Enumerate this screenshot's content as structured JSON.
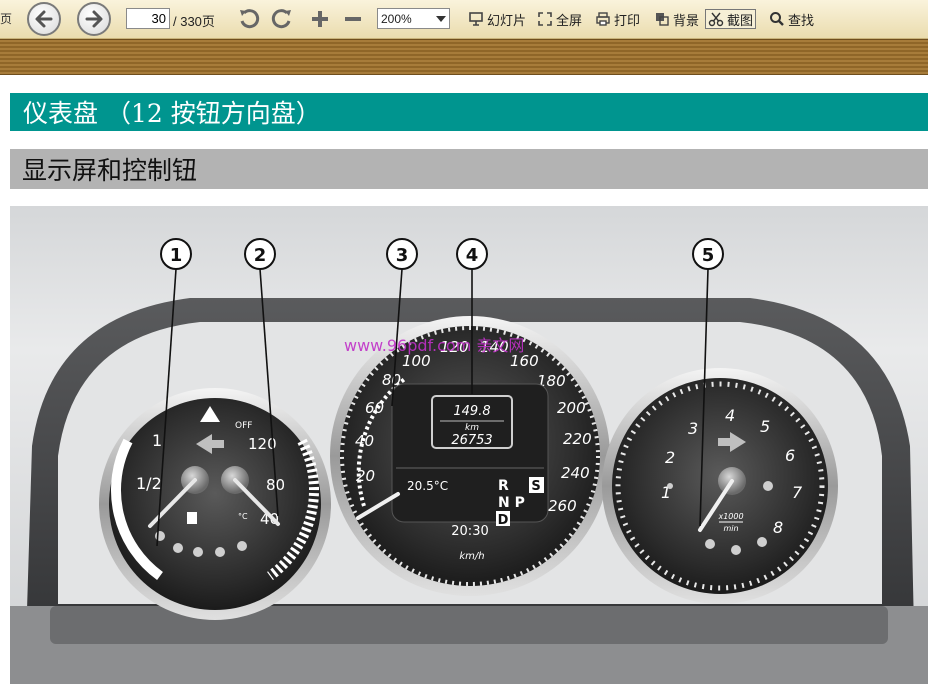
{
  "toolbar": {
    "edge_label": "页",
    "page_number": "30",
    "page_total": "/ 330页",
    "zoom_value": "200%",
    "tools": {
      "slideshow": "幻灯片",
      "fullscreen": "全屏",
      "print": "打印",
      "background": "背景",
      "screenshot": "截图",
      "search": "查找"
    }
  },
  "document": {
    "heading1": "仪表盘 （12 按钮方向盘）",
    "heading2": "显示屏和控制钮"
  },
  "dashboard": {
    "callouts": [
      "1",
      "2",
      "3",
      "4",
      "5"
    ],
    "watermark": "www.96pdf.com 亲文网",
    "left_gauge": {
      "fuel_labels": [
        "1",
        "1/2"
      ],
      "temp_labels": [
        "120",
        "80",
        "40"
      ],
      "warning_off_label": "OFF",
      "temp_unit_label": "°C"
    },
    "speedometer": {
      "labels": [
        "20",
        "40",
        "60",
        "80",
        "100",
        "120",
        "140",
        "160",
        "180",
        "200",
        "220",
        "240",
        "260"
      ],
      "unit": "km/h",
      "trip": "149.8",
      "odo_unit": "km",
      "odometer": "26753",
      "outside_temp": "20.5°C",
      "time": "20:30",
      "gear_r": "R",
      "gear_np": "N P",
      "gear_d": "D",
      "gear_s": "S"
    },
    "tachometer": {
      "labels": [
        "1",
        "2",
        "3",
        "4",
        "5",
        "6",
        "7",
        "8"
      ],
      "unit_top": "x1000",
      "unit_bottom": "min"
    }
  },
  "colors": {
    "heading1_bg": "#00958f",
    "heading2_bg": "#b3b3b3",
    "toolbar_bg": "#eadcae",
    "watermark": "#c030c8"
  }
}
